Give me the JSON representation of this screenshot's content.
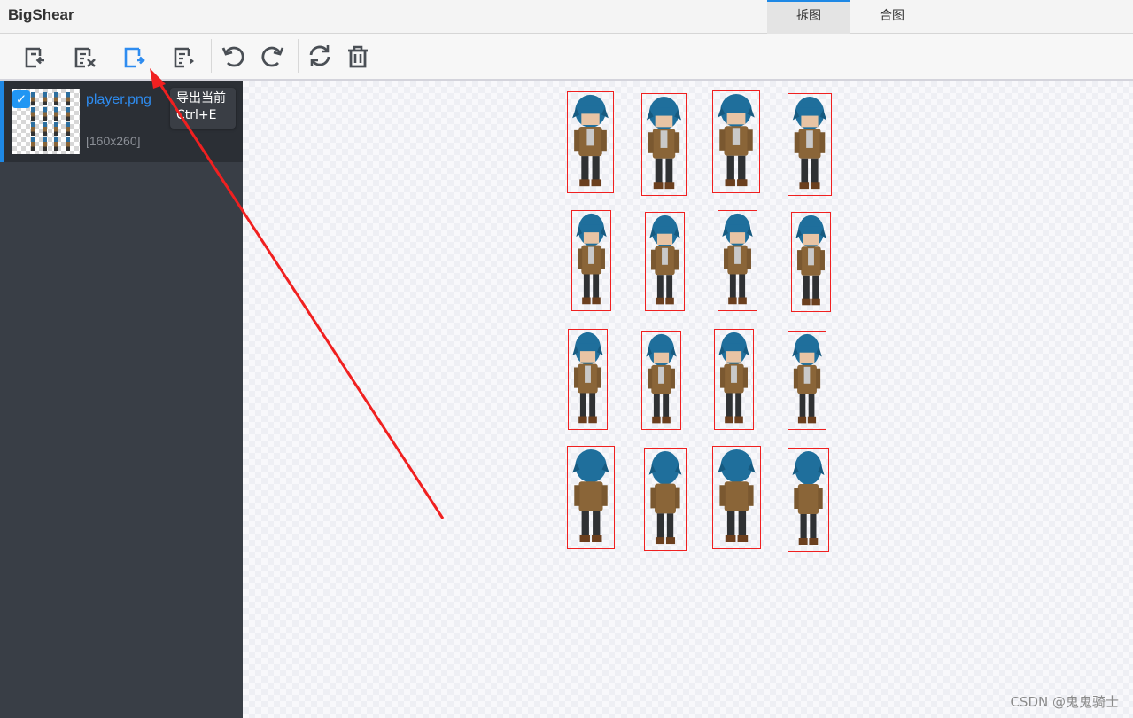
{
  "app": {
    "title": "BigShear"
  },
  "tabs": [
    {
      "label": "拆图",
      "active": true
    },
    {
      "label": "合图",
      "active": false
    }
  ],
  "toolbar": {
    "buttons": [
      {
        "icon": "import-file-icon"
      },
      {
        "icon": "clear-file-icon"
      },
      {
        "icon": "export-current-icon",
        "active": true
      },
      {
        "icon": "export-all-icon"
      },
      {
        "icon": "undo-icon"
      },
      {
        "icon": "redo-icon"
      },
      {
        "icon": "refresh-icon"
      },
      {
        "icon": "trash-icon"
      }
    ],
    "active_color": "#2e8cf0",
    "icon_color": "#4a4f55"
  },
  "tooltip": {
    "line1": "导出当前",
    "line2": "Ctrl+E"
  },
  "file_list": [
    {
      "name": "player.png",
      "size": "[160x260]",
      "checked": true
    }
  ],
  "canvas": {
    "sprite_rows": 4,
    "sprite_cols": 4,
    "box_color": "#f02020"
  },
  "watermark": "CSDN @鬼鬼骑士"
}
